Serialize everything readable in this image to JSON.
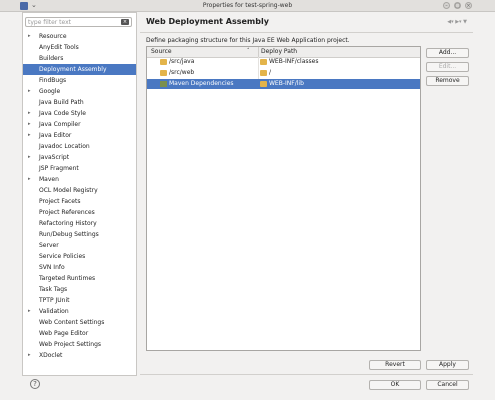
{
  "window": {
    "title": "Properties for test-spring-web"
  },
  "filter": {
    "placeholder": "type filter text"
  },
  "tree": [
    {
      "label": "Resource",
      "expandable": true
    },
    {
      "label": "AnyEdit Tools",
      "expandable": false
    },
    {
      "label": "Builders",
      "expandable": false
    },
    {
      "label": "Deployment Assembly",
      "expandable": false,
      "selected": true
    },
    {
      "label": "FindBugs",
      "expandable": false
    },
    {
      "label": "Google",
      "expandable": true
    },
    {
      "label": "Java Build Path",
      "expandable": false
    },
    {
      "label": "Java Code Style",
      "expandable": true
    },
    {
      "label": "Java Compiler",
      "expandable": true
    },
    {
      "label": "Java Editor",
      "expandable": true
    },
    {
      "label": "Javadoc Location",
      "expandable": false
    },
    {
      "label": "JavaScript",
      "expandable": true
    },
    {
      "label": "JSP Fragment",
      "expandable": false
    },
    {
      "label": "Maven",
      "expandable": true
    },
    {
      "label": "OCL Model Registry",
      "expandable": false
    },
    {
      "label": "Project Facets",
      "expandable": false
    },
    {
      "label": "Project References",
      "expandable": false
    },
    {
      "label": "Refactoring History",
      "expandable": false
    },
    {
      "label": "Run/Debug Settings",
      "expandable": false
    },
    {
      "label": "Server",
      "expandable": false
    },
    {
      "label": "Service Policies",
      "expandable": false
    },
    {
      "label": "SVN Info",
      "expandable": false
    },
    {
      "label": "Targeted Runtimes",
      "expandable": false
    },
    {
      "label": "Task Tags",
      "expandable": false
    },
    {
      "label": "TPTP JUnit",
      "expandable": false
    },
    {
      "label": "Validation",
      "expandable": true
    },
    {
      "label": "Web Content Settings",
      "expandable": false
    },
    {
      "label": "Web Page Editor",
      "expandable": false
    },
    {
      "label": "Web Project Settings",
      "expandable": false
    },
    {
      "label": "XDoclet",
      "expandable": true
    }
  ],
  "page": {
    "title": "Web Deployment Assembly",
    "description": "Define packaging structure for this Java EE Web Application project."
  },
  "table": {
    "columns": [
      "Source",
      "Deploy Path"
    ],
    "rows": [
      {
        "source": "/src/java",
        "deploy": "WEB-INF/classes",
        "selected": false,
        "icon": "folder-icon"
      },
      {
        "source": "/src/web",
        "deploy": "/",
        "selected": false,
        "icon": "folder-icon"
      },
      {
        "source": "Maven Dependencies",
        "deploy": "WEB-INF/lib",
        "selected": true,
        "icon": "library-icon"
      }
    ]
  },
  "buttons": {
    "add": "Add...",
    "edit": "Edit...",
    "remove": "Remove",
    "revert": "Revert",
    "apply": "Apply",
    "ok": "OK",
    "cancel": "Cancel"
  },
  "help": "?"
}
